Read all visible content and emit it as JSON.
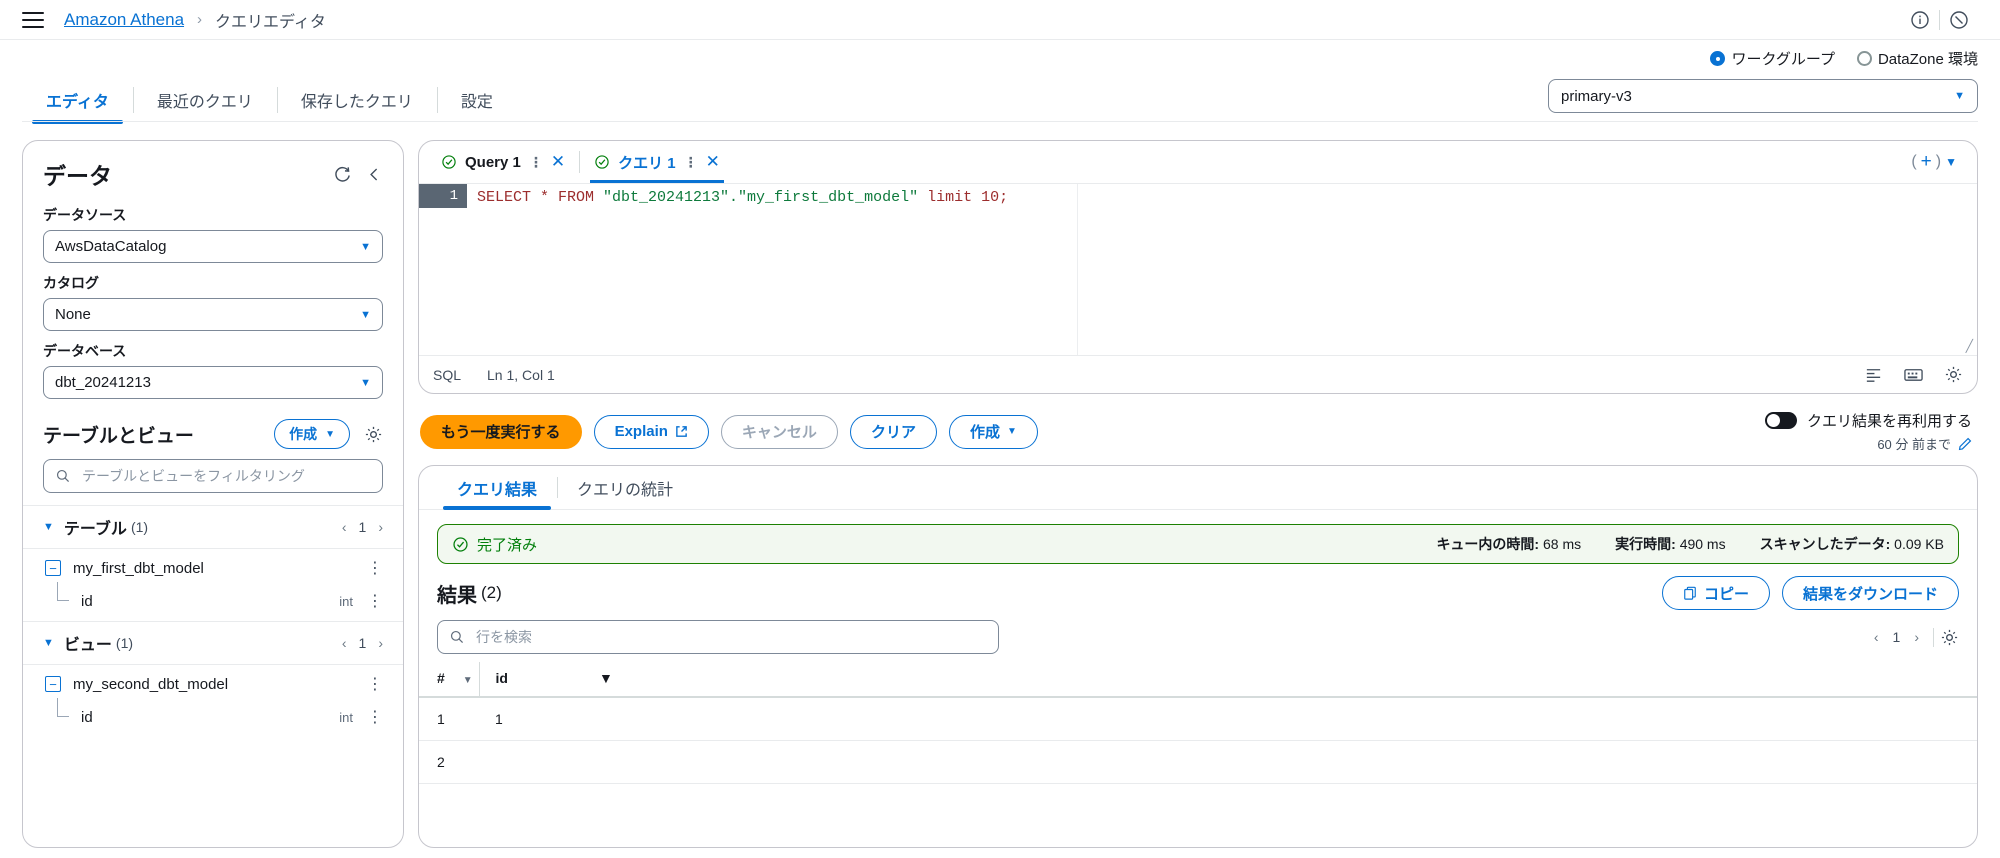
{
  "header": {
    "menu_icon": "hamburger-icon",
    "breadcrumb_root": "Amazon Athena",
    "breadcrumb_separator": "›",
    "breadcrumb_current": "クエリエディタ",
    "info_icon": "info-icon",
    "notifications_icon": "notification-icon"
  },
  "workgroup": {
    "radio_workgroup_label": "ワークグループ",
    "radio_datazone_label": "DataZone 環境",
    "selected_radio": "workgroup",
    "selected_value": "primary-v3",
    "caret": "▼"
  },
  "nav_tabs": [
    {
      "label": "エディタ",
      "active": true
    },
    {
      "label": "最近のクエリ",
      "active": false
    },
    {
      "label": "保存したクエリ",
      "active": false
    },
    {
      "label": "設定",
      "active": false
    }
  ],
  "data_panel": {
    "title": "データ",
    "refresh_icon": "refresh-icon",
    "collapse_icon": "chevron-left-icon",
    "data_source": {
      "label": "データソース",
      "value": "AwsDataCatalog"
    },
    "catalog": {
      "label": "カタログ",
      "value": "None"
    },
    "database": {
      "label": "データベース",
      "value": "dbt_20241213"
    },
    "tables_views": {
      "title": "テーブルとビュー",
      "create_button": "作成",
      "create_caret": "▼",
      "gear_icon": "gear-icon",
      "filter_placeholder": "テーブルとビューをフィルタリング",
      "filter_value": "",
      "search_icon": "search-icon"
    },
    "groups": [
      {
        "name": "テーブル",
        "count": "(1)",
        "page": "1",
        "items": [
          {
            "name": "my_first_dbt_model",
            "toggle": "−",
            "columns": [
              {
                "name": "id",
                "type": "int"
              }
            ]
          }
        ]
      },
      {
        "name": "ビュー",
        "count": "(1)",
        "page": "1",
        "items": [
          {
            "name": "my_second_dbt_model",
            "toggle": "−",
            "columns": [
              {
                "name": "id",
                "type": "int"
              }
            ]
          }
        ]
      }
    ]
  },
  "editor": {
    "tabs": [
      {
        "label": "Query 1",
        "active": false,
        "status_icon": "check-circle-icon",
        "menu_icon": "vertical-dots-icon",
        "close_icon": "close-icon"
      },
      {
        "label": "クエリ 1",
        "active": true,
        "status_icon": "check-circle-icon",
        "menu_icon": "vertical-dots-icon",
        "close_icon": "close-icon"
      }
    ],
    "tab_actions": {
      "left_paren": "(",
      "add": "+",
      "right_paren": ")",
      "caret": "▼"
    },
    "line_number": "1",
    "sql_tokens": [
      {
        "text": "SELECT * FROM ",
        "type": "keyword"
      },
      {
        "text": "\"dbt_20241213\".\"my_first_dbt_model\"",
        "type": "string"
      },
      {
        "text": " limit ",
        "type": "keyword"
      },
      {
        "text": "10;",
        "type": "number"
      }
    ],
    "status": {
      "language": "SQL",
      "cursor": "Ln 1, Col 1"
    },
    "status_icons": [
      "format-icon",
      "keyboard-icon",
      "gear-icon"
    ]
  },
  "actions": {
    "run_again": "もう一度実行する",
    "explain": "Explain",
    "explain_external_icon": "external-link-icon",
    "cancel": "キャンセル",
    "clear": "クリア",
    "create": "作成",
    "create_caret": "▼",
    "reuse_toggle_label": "クエリ結果を再利用する",
    "reuse_sub": "60 分 前まで",
    "reuse_edit_icon": "pencil-icon",
    "reuse_on": false
  },
  "results": {
    "tabs": [
      {
        "label": "クエリ結果",
        "active": true
      },
      {
        "label": "クエリの統計",
        "active": false
      }
    ],
    "status_banner": {
      "icon": "check-circle-icon",
      "text": "完了済み",
      "metrics": [
        {
          "label": "キュー内の時間:",
          "value": "68 ms"
        },
        {
          "label": "実行時間:",
          "value": "490 ms"
        },
        {
          "label": "スキャンしたデータ:",
          "value": "0.09 KB"
        }
      ]
    },
    "title": "結果",
    "count": "(2)",
    "copy_button": "コピー",
    "copy_icon": "copy-icon",
    "download_button": "結果をダウンロード",
    "search_placeholder": "行を検索",
    "search_value": "",
    "search_icon": "search-icon",
    "page": "1",
    "settings_icon": "gear-icon",
    "columns": [
      "#",
      "id"
    ],
    "sort_icon": "sort-icon",
    "rows": [
      {
        "num": "1",
        "id": "1"
      },
      {
        "num": "2",
        "id": ""
      }
    ]
  }
}
